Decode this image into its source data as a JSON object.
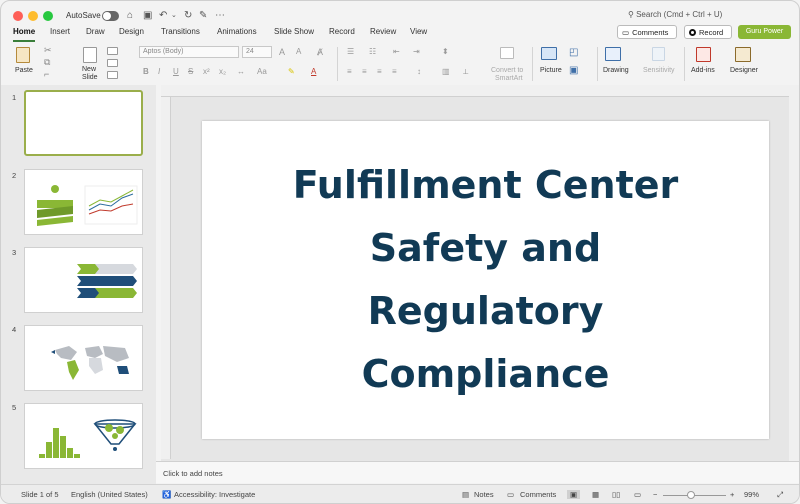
{
  "titlebar": {
    "autosave_label": "AutoSave",
    "search_placeholder": "Search (Cmd + Ctrl + U)"
  },
  "tabs": [
    "Home",
    "Insert",
    "Draw",
    "Design",
    "Transitions",
    "Animations",
    "Slide Show",
    "Record",
    "Review",
    "View"
  ],
  "header_buttons": {
    "comments": "Comments",
    "record": "Record",
    "guru": "Guru Power"
  },
  "ribbon": {
    "paste": "Paste",
    "new_slide_1": "New",
    "new_slide_2": "Slide",
    "font_name": "Aptos (Body)",
    "font_size": "24",
    "convert_1": "Convert to",
    "convert_2": "SmartArt",
    "picture": "Picture",
    "drawing": "Drawing",
    "sensitivity": "Sensitivity",
    "addins": "Add-ins",
    "designer": "Designer",
    "format_buttons": [
      "B",
      "I",
      "U",
      "S",
      "x²",
      "x₂"
    ]
  },
  "colors": {
    "accent_green": "#8ab735",
    "title_navy": "#113a55",
    "tab_underline": "#3a7e3a"
  },
  "thumbnails": [
    {
      "number": "1"
    },
    {
      "number": "2"
    },
    {
      "number": "3"
    },
    {
      "number": "4"
    },
    {
      "number": "5"
    }
  ],
  "slide": {
    "title": "Fulfillment Center\nSafety and\nRegulatory\nCompliance"
  },
  "notes_placeholder": "Click to add notes",
  "status": {
    "slide_of": "Slide 1 of 5",
    "language": "English (United States)",
    "accessibility": "Accessibility: Investigate",
    "notes": "Notes",
    "comments": "Comments",
    "zoom": "99%"
  }
}
